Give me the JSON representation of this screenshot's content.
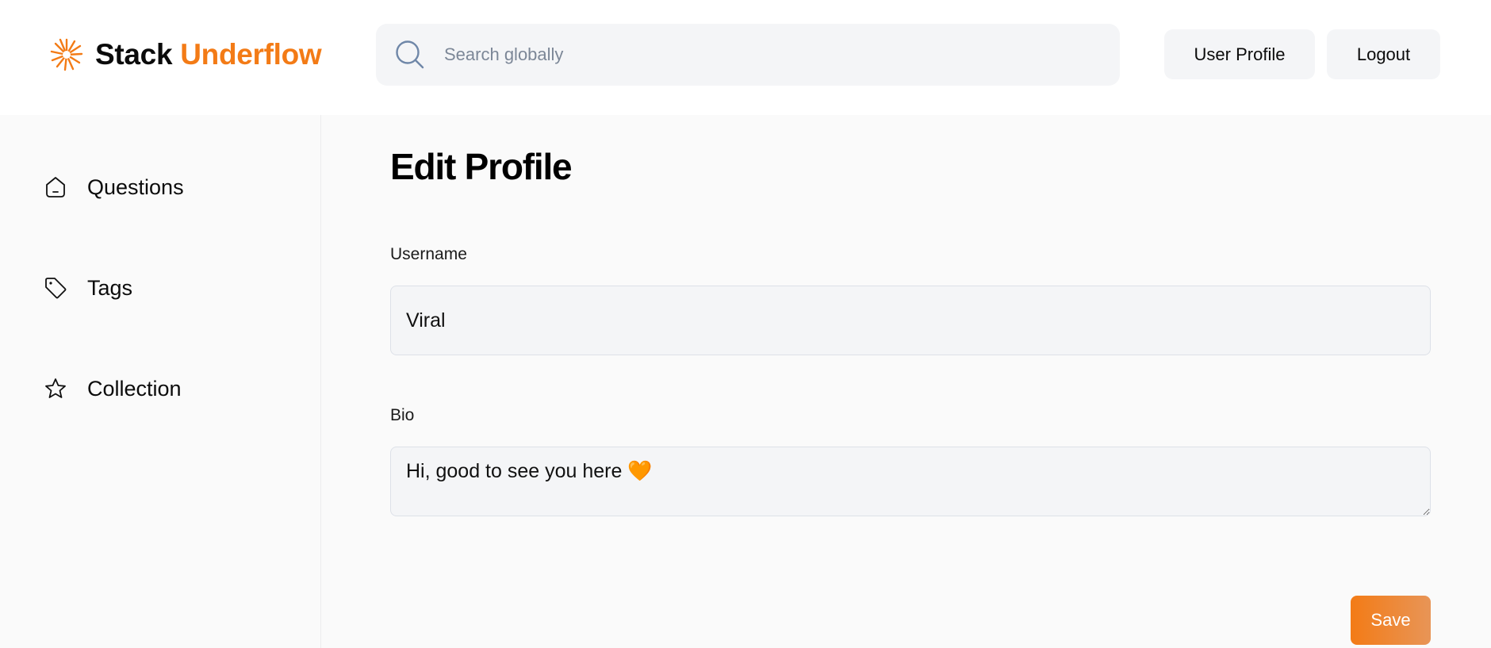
{
  "brand": {
    "name_part1": "Stack",
    "name_part2": "Underflow",
    "accent_color": "#f37b16",
    "logo_icon": "sunburst-logo-icon"
  },
  "search": {
    "placeholder": "Search globally",
    "value": "",
    "icon": "search-icon"
  },
  "header_buttons": {
    "profile_label": "User Profile",
    "logout_label": "Logout"
  },
  "sidebar": {
    "items": [
      {
        "label": "Questions",
        "icon": "home-icon"
      },
      {
        "label": "Tags",
        "icon": "tag-icon"
      },
      {
        "label": "Collection",
        "icon": "star-icon"
      }
    ]
  },
  "main": {
    "title": "Edit Profile",
    "username": {
      "label": "Username",
      "value": "Viral"
    },
    "bio": {
      "label": "Bio",
      "value": "Hi, good to see you here 🧡"
    },
    "save_label": "Save"
  }
}
